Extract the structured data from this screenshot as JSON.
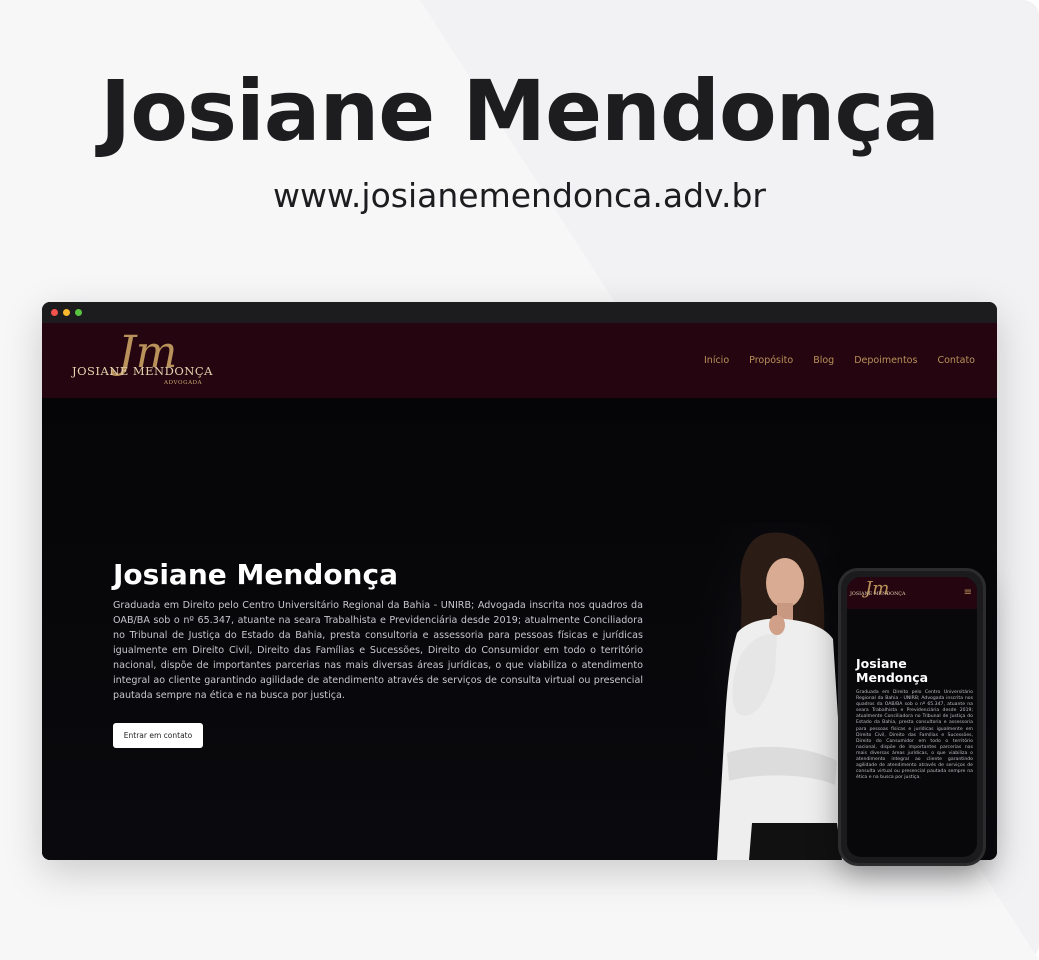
{
  "banner": {
    "title": "Josiane Mendonça",
    "url": "www.josianemendonca.adv.br"
  },
  "site": {
    "logo": {
      "monogram": "Jm",
      "name": "JOSIANE MENDONÇA",
      "subtitle": "ADVOGADA"
    },
    "nav": [
      "Início",
      "Propósito",
      "Blog",
      "Depoimentos",
      "Contato"
    ],
    "hero": {
      "heading": "Josiane Mendonça",
      "text": "Graduada em Direito pelo Centro Universitário Regional da Bahia - UNIRB; Advogada inscrita nos quadros da OAB/BA sob o nº 65.347, atuante na seara Trabalhista e Previdenciária desde 2019; atualmente Conciliadora no Tribunal de Justiça do Estado da Bahia, presta consultoria e assessoria para pessoas físicas e jurídicas igualmente em Direito Civil, Direito das Famílias e Sucessões, Direito do Consumidor em todo o território nacional, dispõe de importantes parcerias nas mais diversas áreas jurídicas, o que viabiliza o atendimento integral ao cliente garantindo agilidade de atendimento através de serviços de consulta virtual ou presencial pautada sempre na ética e na busca por justiça.",
      "cta": "Entrar em contato"
    }
  },
  "phone": {
    "menu_icon": "≡",
    "heading": "Josiane Mendonça",
    "text": "Graduada em Direito pelo Centro Universitário Regional da Bahia - UNIRB; Advogada inscrita nos quadros da OAB/BA sob o nº 65.347, atuante na seara Trabalhista e Previdenciária desde 2019; atualmente Conciliadora no Tribunal de Justiça do Estado da Bahia, presta consultoria e assessoria para pessoas físicas e jurídicas igualmente em Direito Civil, Direito das Famílias e Sucessões, Direito do Consumidor em todo o território nacional, dispõe de importantes parcerias nas mais diversas áreas jurídicas, o que viabiliza o atendimento integral ao cliente garantindo agilidade de atendimento através de serviços de consulta virtual ou presencial pautada sempre na ética e na busca por justiça."
  },
  "colors": {
    "header_bg": "#25050f",
    "accent_gold": "#b8925a",
    "page_dark": "#050507"
  }
}
